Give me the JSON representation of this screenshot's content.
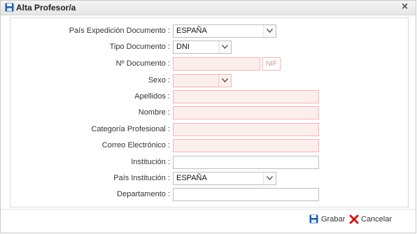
{
  "window": {
    "title": "Alta Profesor/a",
    "close_glyph": "×",
    "title_icon": "save-icon"
  },
  "form": {
    "pais_expedicion": {
      "label": "País Expedición Documento :",
      "value": "ESPAÑA"
    },
    "tipo_documento": {
      "label": "Tipo Documento :",
      "value": "DNI"
    },
    "numero_documento": {
      "label": "Nº Documento :",
      "value": "",
      "nif_button": "NIF"
    },
    "sexo": {
      "label": "Sexo :",
      "value": ""
    },
    "apellidos": {
      "label": "Apellidos :",
      "value": ""
    },
    "nombre": {
      "label": "Nombre :",
      "value": ""
    },
    "categoria_profesional": {
      "label": "Categoría Profesional :",
      "value": ""
    },
    "correo_electronico": {
      "label": "Correo Electrónico :",
      "value": ""
    },
    "institucion": {
      "label": "Institución :",
      "value": ""
    },
    "pais_institucion": {
      "label": "País Institución :",
      "value": "ESPAÑA"
    },
    "departamento": {
      "label": "Departamento :",
      "value": ""
    }
  },
  "footer": {
    "grabar_label": "Grabar",
    "cancelar_label": "Cancelar"
  },
  "colors": {
    "required_border": "#f2b5b5",
    "required_fill": "#fdeeee",
    "save_icon": "#1f5fa8",
    "cancel_icon": "#d0181a"
  }
}
